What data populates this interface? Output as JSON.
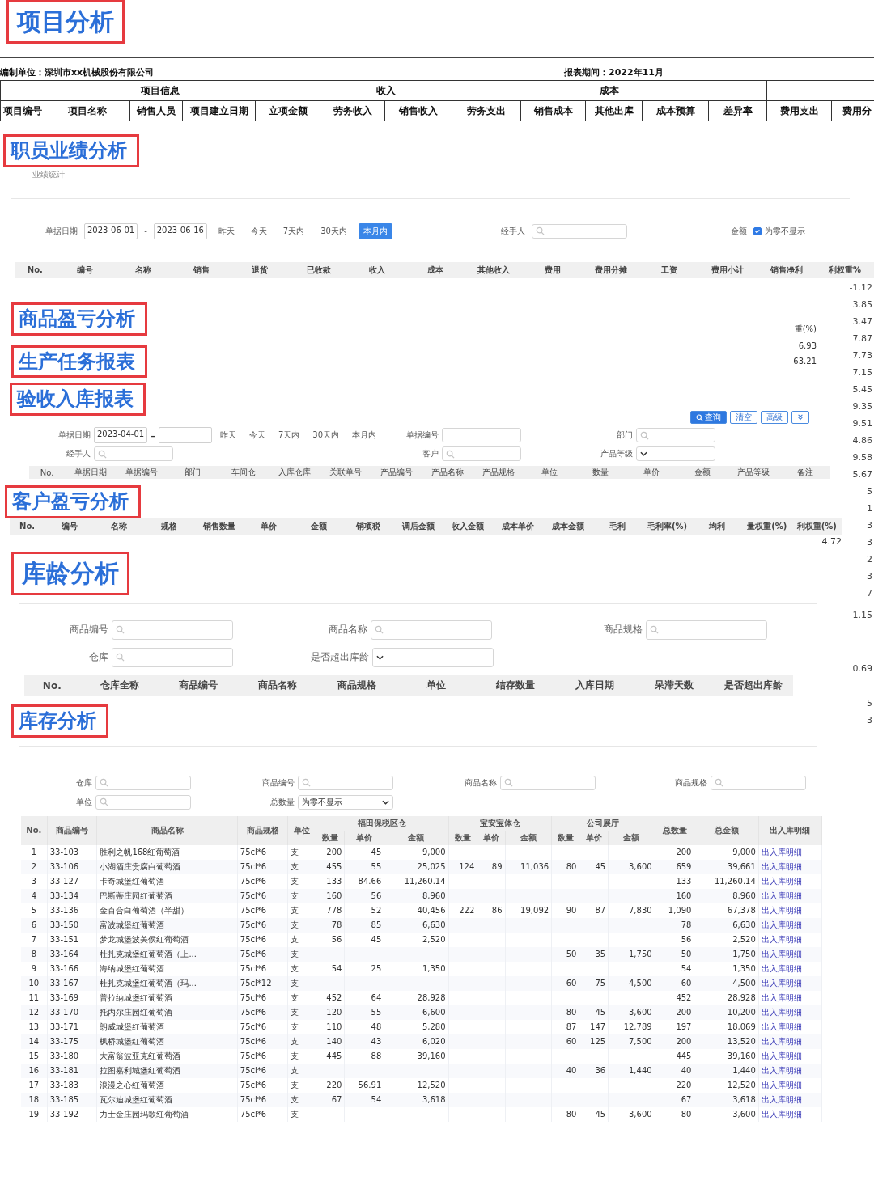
{
  "project": {
    "title": "项目分析",
    "org": "编制单位：深圳市xx机械股份有限公司",
    "period": "报表期间：2022年11月",
    "groups": [
      {
        "name": "项目信息",
        "columns": [
          "项目编号",
          "项目名称",
          "销售人员",
          "项目建立日期",
          "立项金额"
        ]
      },
      {
        "name": "收入",
        "columns": [
          "劳务收入",
          "销售收入"
        ]
      },
      {
        "name": "成本",
        "columns": [
          "劳务支出",
          "销售成本",
          "其他出库",
          "成本预算",
          "差异率"
        ]
      },
      {
        "columns": [
          "费用支出",
          "费用分"
        ]
      }
    ]
  },
  "staff": {
    "title": "职员业绩分析",
    "subtitle": "业绩统计",
    "date_label": "单据日期",
    "date_from": "2023-06-01",
    "date_sep": "-",
    "date_to": "2023-06-16",
    "ranges": [
      {
        "label": "昨天",
        "selected": false
      },
      {
        "label": "今天",
        "selected": false
      },
      {
        "label": "7天内",
        "selected": false
      },
      {
        "label": "30天内",
        "selected": false
      },
      {
        "label": "本月内",
        "selected": true
      }
    ],
    "handler_label": "经手人",
    "amount_label": "金额",
    "hide_zero": {
      "label": "为零不显示",
      "checked": true
    },
    "columns": [
      "No.",
      "编号",
      "名称",
      "销售",
      "退货",
      "已收款",
      "收入",
      "成本",
      "其他收入",
      "费用",
      "费用分摊",
      "工资",
      "费用小计",
      "销售净利",
      "利权重%"
    ]
  },
  "profit_title": "商品盈亏分析",
  "production_title": "生产任务报表",
  "fragment": {
    "header": "重(%)",
    "values": [
      "6.93",
      "63.21"
    ]
  },
  "receipt": {
    "title": "验收入库报表",
    "buttons": [
      {
        "kind": "primary",
        "label": "查询"
      },
      {
        "kind": "plain",
        "label": "清空"
      },
      {
        "kind": "plain",
        "label": "高级"
      },
      {
        "kind": "expand"
      }
    ],
    "date_label": "单据日期",
    "date_from": "2023-04-01",
    "date_sep": "-",
    "ranges": [
      {
        "label": "昨天",
        "selected": false
      },
      {
        "label": "今天",
        "selected": false
      },
      {
        "label": "7天内",
        "selected": false
      },
      {
        "label": "30天内",
        "selected": false
      },
      {
        "label": "本月内",
        "selected": false
      }
    ],
    "filters": [
      {
        "label": "单据编号",
        "kind": "text"
      },
      {
        "label": "部门",
        "kind": "search"
      },
      {
        "label": "经手人",
        "kind": "search"
      },
      {
        "label": "客户",
        "kind": "search"
      },
      {
        "label": "产品等级",
        "kind": "select"
      }
    ],
    "columns": [
      "No.",
      "单据日期",
      "单据编号",
      "部门",
      "车间仓",
      "入库仓库",
      "关联单号",
      "产品编号",
      "产品名称",
      "产品规格",
      "单位",
      "数量",
      "单价",
      "金额",
      "产品等级",
      "备注"
    ]
  },
  "customer": {
    "title": "客户盈亏分析",
    "columns": [
      "No.",
      "编号",
      "名称",
      "规格",
      "销售数量",
      "单价",
      "金额",
      "销项税",
      "调后金额",
      "收入金额",
      "成本单价",
      "成本金额",
      "毛利",
      "毛利率(%)",
      "均利",
      "量权重(%)",
      "利权重(%)"
    ],
    "cut_value": "4.72"
  },
  "stock_age": {
    "title": "库龄分析",
    "filters": [
      {
        "label": "商品编号",
        "kind": "search"
      },
      {
        "label": "商品名称",
        "kind": "search"
      },
      {
        "label": "商品规格",
        "kind": "search"
      },
      {
        "label": "仓库",
        "kind": "search"
      },
      {
        "label": "是否超出库龄",
        "kind": "select"
      }
    ],
    "columns": [
      "No.",
      "仓库全称",
      "商品编号",
      "商品名称",
      "商品规格",
      "单位",
      "结存数量",
      "入库日期",
      "呆滞天数",
      "是否超出库龄"
    ]
  },
  "stock": {
    "title": "库存分析",
    "filters": [
      {
        "label": "仓库",
        "kind": "search"
      },
      {
        "label": "商品编号",
        "kind": "search"
      },
      {
        "label": "商品名称",
        "kind": "search"
      },
      {
        "label": "商品规格",
        "kind": "search"
      },
      {
        "label": "单位",
        "kind": "search"
      },
      {
        "label": "总数量",
        "kind": "select",
        "value": "为零不显示"
      }
    ],
    "lead_columns": [
      "No.",
      "商品编号",
      "商品名称",
      "商品规格",
      "单位"
    ],
    "groups": [
      {
        "name": "福田保税区仓",
        "columns": [
          "数量",
          "单价",
          "金额"
        ]
      },
      {
        "name": "宝安宝体仓",
        "columns": [
          "数量",
          "单价",
          "金额"
        ]
      },
      {
        "name": "公司展厅",
        "columns": [
          "数量",
          "单价",
          "金额"
        ]
      }
    ],
    "tail_columns": [
      "总数量",
      "总金额",
      "出入库明细"
    ],
    "rows": [
      {
        "no": "1",
        "code": "33-103",
        "name": "胜利之帆168红葡萄酒",
        "spec": "75cl*6",
        "unit": "支",
        "stock_1": {
          "qty": "200",
          "price": "45",
          "amount": "9,000"
        },
        "total_qty": "200",
        "total_amount": "9,000",
        "detail": "出入库明细"
      },
      {
        "no": "2",
        "code": "33-106",
        "name": "小湖酒庄贵腐白葡萄酒",
        "spec": "75cl*6",
        "unit": "支",
        "stock_1": {
          "qty": "455",
          "price": "55",
          "amount": "25,025"
        },
        "stock_2": {
          "qty": "124",
          "price": "89",
          "amount": "11,036"
        },
        "stock_3": {
          "qty": "80",
          "price": "45",
          "amount": "3,600"
        },
        "total_qty": "659",
        "total_amount": "39,661",
        "detail": "出入库明细"
      },
      {
        "no": "3",
        "code": "33-127",
        "name": "卡奇城堡红葡萄酒",
        "spec": "75cl*6",
        "unit": "支",
        "stock_1": {
          "qty": "133",
          "price": "84.66",
          "amount": "11,260.14"
        },
        "total_qty": "133",
        "total_amount": "11,260.14",
        "detail": "出入库明细"
      },
      {
        "no": "4",
        "code": "33-134",
        "name": "巴斯蒂庄园红葡萄酒",
        "spec": "75cl*6",
        "unit": "支",
        "stock_1": {
          "qty": "160",
          "price": "56",
          "amount": "8,960"
        },
        "total_qty": "160",
        "total_amount": "8,960",
        "detail": "出入库明细"
      },
      {
        "no": "5",
        "code": "33-136",
        "name": "金百合白葡萄酒（半甜）",
        "spec": "75cl*6",
        "unit": "支",
        "stock_1": {
          "qty": "778",
          "price": "52",
          "amount": "40,456"
        },
        "stock_2": {
          "qty": "222",
          "price": "86",
          "amount": "19,092"
        },
        "stock_3": {
          "qty": "90",
          "price": "87",
          "amount": "7,830"
        },
        "total_qty": "1,090",
        "total_amount": "67,378",
        "detail": "出入库明细"
      },
      {
        "no": "6",
        "code": "33-150",
        "name": "富波城堡红葡萄酒",
        "spec": "75cl*6",
        "unit": "支",
        "stock_1": {
          "qty": "78",
          "price": "85",
          "amount": "6,630"
        },
        "total_qty": "78",
        "total_amount": "6,630",
        "detail": "出入库明细"
      },
      {
        "no": "7",
        "code": "33-151",
        "name": "梦龙城堡波美侯红葡萄酒",
        "spec": "75cl*6",
        "unit": "支",
        "stock_1": {
          "qty": "56",
          "price": "45",
          "amount": "2,520"
        },
        "total_qty": "56",
        "total_amount": "2,520",
        "detail": "出入库明细"
      },
      {
        "no": "8",
        "code": "33-164",
        "name": "杜扎克城堡红葡萄酒（上...",
        "spec": "75cl*6",
        "unit": "支",
        "stock_3": {
          "qty": "50",
          "price": "35",
          "amount": "1,750"
        },
        "total_qty": "50",
        "total_amount": "1,750",
        "detail": "出入库明细"
      },
      {
        "no": "9",
        "code": "33-166",
        "name": "海纳城堡红葡萄酒",
        "spec": "75cl*6",
        "unit": "支",
        "stock_1": {
          "qty": "54",
          "price": "25",
          "amount": "1,350"
        },
        "total_qty": "54",
        "total_amount": "1,350",
        "detail": "出入库明细"
      },
      {
        "no": "10",
        "code": "33-167",
        "name": "杜扎克城堡红葡萄酒（玛...",
        "spec": "75cl*12",
        "unit": "支",
        "stock_3": {
          "qty": "60",
          "price": "75",
          "amount": "4,500"
        },
        "total_qty": "60",
        "total_amount": "4,500",
        "detail": "出入库明细"
      },
      {
        "no": "11",
        "code": "33-169",
        "name": "普拉纳城堡红葡萄酒",
        "spec": "75cl*6",
        "unit": "支",
        "stock_1": {
          "qty": "452",
          "price": "64",
          "amount": "28,928"
        },
        "total_qty": "452",
        "total_amount": "28,928",
        "detail": "出入库明细"
      },
      {
        "no": "12",
        "code": "33-170",
        "name": "托内尔庄园红葡萄酒",
        "spec": "75cl*6",
        "unit": "支",
        "stock_1": {
          "qty": "120",
          "price": "55",
          "amount": "6,600"
        },
        "stock_3": {
          "qty": "80",
          "price": "45",
          "amount": "3,600"
        },
        "total_qty": "200",
        "total_amount": "10,200",
        "detail": "出入库明细"
      },
      {
        "no": "13",
        "code": "33-171",
        "name": "朗威城堡红葡萄酒",
        "spec": "75cl*6",
        "unit": "支",
        "stock_1": {
          "qty": "110",
          "price": "48",
          "amount": "5,280"
        },
        "stock_3": {
          "qty": "87",
          "price": "147",
          "amount": "12,789"
        },
        "total_qty": "197",
        "total_amount": "18,069",
        "detail": "出入库明细"
      },
      {
        "no": "14",
        "code": "33-175",
        "name": "枫桥城堡红葡萄酒",
        "spec": "75cl*6",
        "unit": "支",
        "stock_1": {
          "qty": "140",
          "price": "43",
          "amount": "6,020"
        },
        "stock_3": {
          "qty": "60",
          "price": "125",
          "amount": "7,500"
        },
        "total_qty": "200",
        "total_amount": "13,520",
        "detail": "出入库明细"
      },
      {
        "no": "15",
        "code": "33-180",
        "name": "大富翁波亚克红葡萄酒",
        "spec": "75cl*6",
        "unit": "支",
        "stock_1": {
          "qty": "445",
          "price": "88",
          "amount": "39,160"
        },
        "total_qty": "445",
        "total_amount": "39,160",
        "detail": "出入库明细"
      },
      {
        "no": "16",
        "code": "33-181",
        "name": "拉图嘉利城堡红葡萄酒",
        "spec": "75cl*6",
        "unit": "支",
        "stock_3": {
          "qty": "40",
          "price": "36",
          "amount": "1,440"
        },
        "total_qty": "40",
        "total_amount": "1,440",
        "detail": "出入库明细"
      },
      {
        "no": "17",
        "code": "33-183",
        "name": "浪漫之心红葡萄酒",
        "spec": "75cl*6",
        "unit": "支",
        "stock_1": {
          "qty": "220",
          "price": "56.91",
          "amount": "12,520"
        },
        "total_qty": "220",
        "total_amount": "12,520",
        "detail": "出入库明细"
      },
      {
        "no": "18",
        "code": "33-185",
        "name": "瓦尔迪城堡红葡萄酒",
        "spec": "75cl*6",
        "unit": "支",
        "stock_1": {
          "qty": "67",
          "price": "54",
          "amount": "3,618"
        },
        "total_qty": "67",
        "total_amount": "3,618",
        "detail": "出入库明细"
      },
      {
        "no": "19",
        "code": "33-192",
        "name": "力士金庄园玛歌红葡萄酒",
        "spec": "75cl*6",
        "unit": "支",
        "stock_3": {
          "qty": "80",
          "price": "45",
          "amount": "3,600"
        },
        "total_qty": "80",
        "total_amount": "3,600",
        "detail": "出入库明细"
      }
    ]
  },
  "side_values": {
    "upper": [
      "-1.12",
      "3.85",
      "3.47",
      "7.87",
      "7.73",
      "7.15",
      "5.45",
      "9.35",
      "9.51",
      "4.86",
      "9.58",
      "5.67",
      "5",
      "1",
      "3",
      "3",
      "2",
      "3",
      "7"
    ],
    "middle": [
      "1.15",
      "0.69"
    ],
    "lower": [
      "5",
      "3"
    ]
  }
}
